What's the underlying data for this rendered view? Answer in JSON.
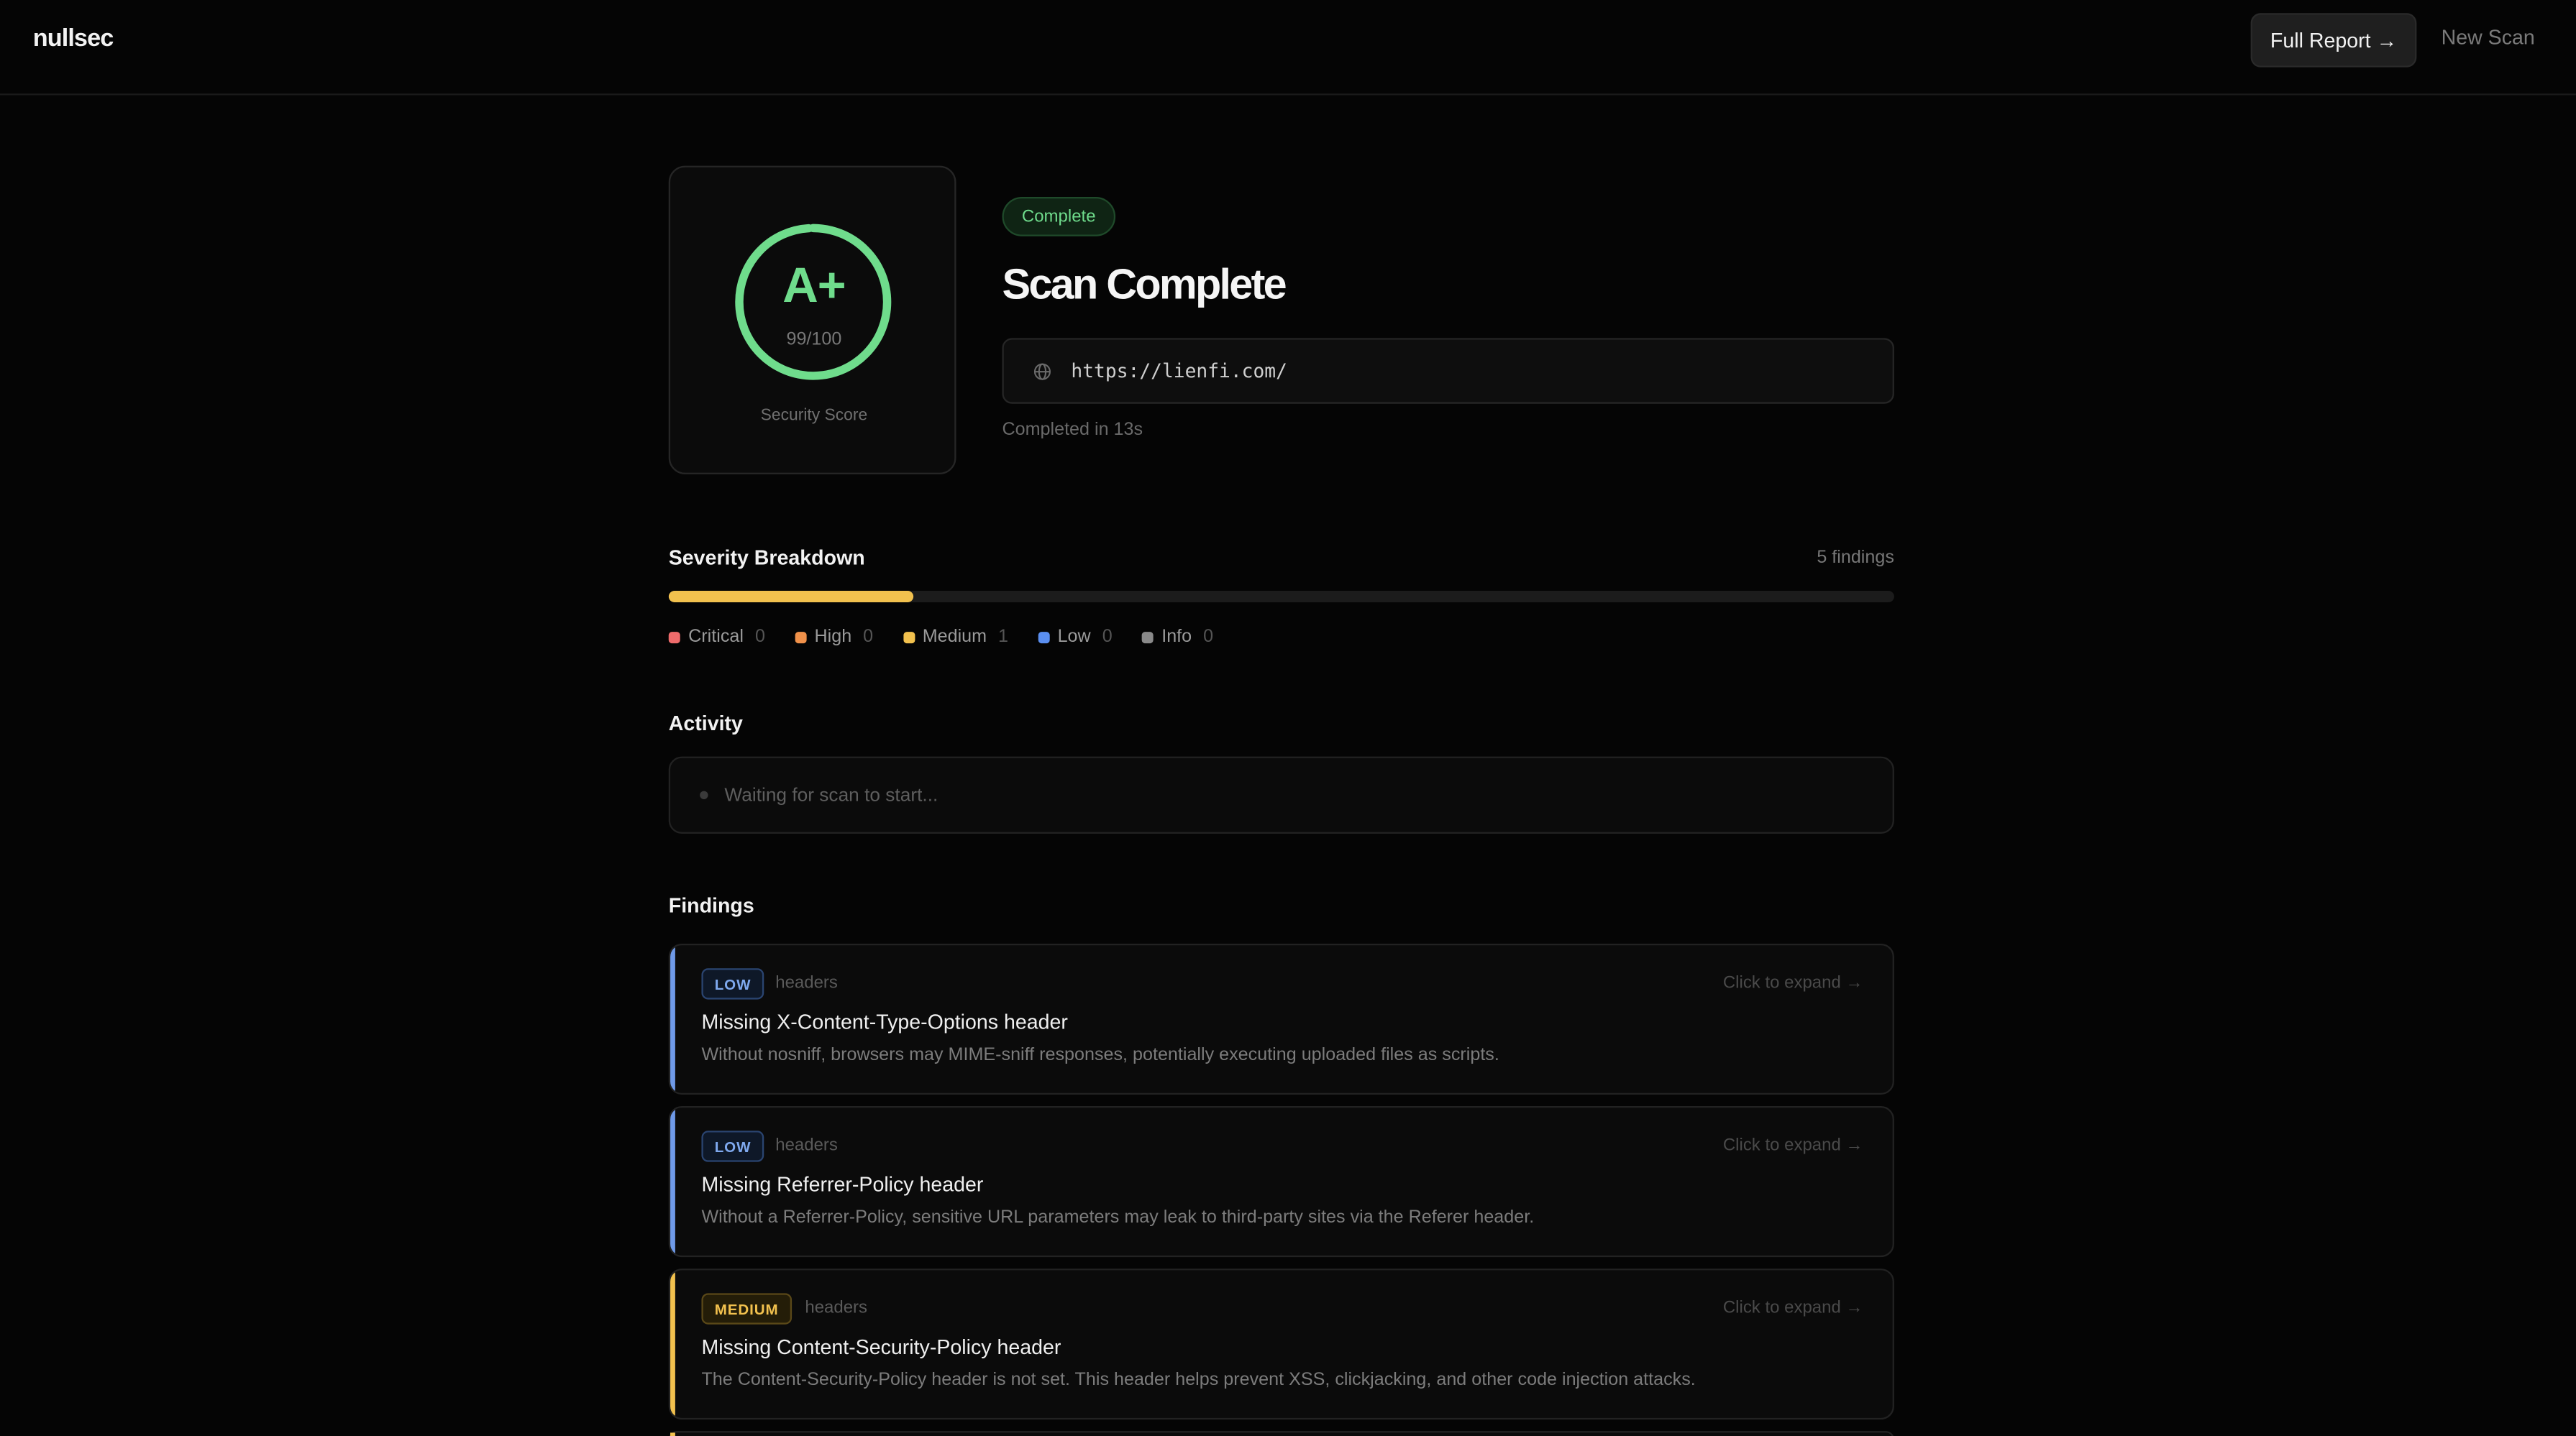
{
  "header": {
    "logo": "nullsec",
    "full_report_label": "Full Report →",
    "new_scan_label": "New Scan"
  },
  "score": {
    "grade": "A+",
    "value_text": "99/100",
    "value": 99,
    "label": "Security Score",
    "ring_color": "#6fdc8c"
  },
  "scan": {
    "status": "Complete",
    "title": "Scan Complete",
    "url": "https://lienfi.com/",
    "completed_text": "Completed in 13s",
    "url_icon": "globe-icon"
  },
  "severity": {
    "title": "Severity Breakdown",
    "findings_count": "5 findings",
    "bar_fill_fraction": 0.2,
    "bar_fill_color": "#f2c14e",
    "legend": [
      {
        "label": "Critical",
        "count": "0",
        "color": "#ef6b6b"
      },
      {
        "label": "High",
        "count": "0",
        "color": "#f0914a"
      },
      {
        "label": "Medium",
        "count": "1",
        "color": "#f2c14e"
      },
      {
        "label": "Low",
        "count": "0",
        "color": "#5b8ff0"
      },
      {
        "label": "Info",
        "count": "0",
        "color": "#8a8a8a"
      }
    ]
  },
  "activity": {
    "title": "Activity",
    "message": "Waiting for scan to start..."
  },
  "findings": {
    "title": "Findings",
    "items": [
      {
        "severity": "LOW",
        "category": "headers",
        "expand": "Click to expand →",
        "title": "Missing X-Content-Type-Options header",
        "description": "Without nosniff, browsers may MIME-sniff responses, potentially executing uploaded files as scripts.",
        "accent": "#6f9ae8"
      },
      {
        "severity": "LOW",
        "category": "headers",
        "expand": "Click to expand →",
        "title": "Missing Referrer-Policy header",
        "description": "Without a Referrer-Policy, sensitive URL parameters may leak to third-party sites via the Referer header.",
        "accent": "#6f9ae8"
      },
      {
        "severity": "MEDIUM",
        "category": "headers",
        "expand": "Click to expand →",
        "title": "Missing Content-Security-Policy header",
        "description": "The Content-Security-Policy header is not set. This header helps prevent XSS, clickjacking, and other code injection attacks.",
        "accent": "#f2c14e"
      }
    ]
  }
}
